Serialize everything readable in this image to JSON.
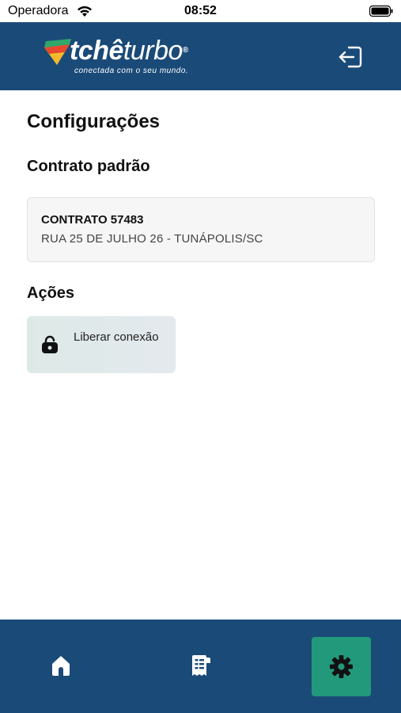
{
  "status_bar": {
    "carrier": "Operadora",
    "time": "08:52"
  },
  "header": {
    "logo_text_bold": "tchê",
    "logo_text_light": "turbo",
    "logo_registered": "®",
    "logo_tagline": "conectada com o seu mundo.",
    "logout_icon": "logout-icon"
  },
  "page": {
    "title": "Configurações"
  },
  "contract_section": {
    "title": "Contrato padrão",
    "contract_name": "CONTRATO 57483",
    "contract_address": "RUA 25 DE JULHO 26 - TUNÁPOLIS/SC"
  },
  "actions_section": {
    "title": "Ações",
    "items": [
      {
        "label": "Liberar conexão",
        "icon": "unlock-icon"
      }
    ]
  },
  "bottom_nav": {
    "items": [
      {
        "icon": "home-icon",
        "active": false
      },
      {
        "icon": "invoice-icon",
        "active": false
      },
      {
        "icon": "gear-icon",
        "active": true
      }
    ],
    "active_color": "#22997a"
  },
  "colors": {
    "brand": "#1a4a78",
    "accent": "#22997a"
  }
}
